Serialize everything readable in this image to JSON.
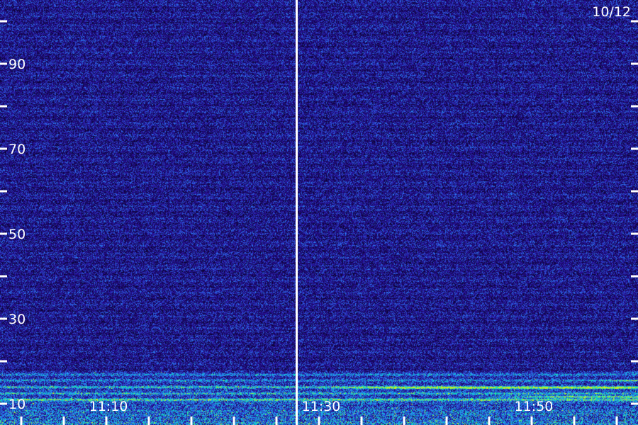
{
  "date_label": "10/12",
  "chart_data": {
    "type": "heatmap",
    "title": "",
    "xlabel": "",
    "ylabel": "",
    "y_range": [
      5,
      105
    ],
    "x_range_minutes": [
      0,
      60
    ],
    "y_ticks": [
      10,
      20,
      30,
      40,
      50,
      60,
      70,
      80,
      90,
      100
    ],
    "y_tick_labels": [
      {
        "value": 10,
        "label": "10"
      },
      {
        "value": 30,
        "label": "30"
      },
      {
        "value": 50,
        "label": "50"
      },
      {
        "value": 70,
        "label": "70"
      },
      {
        "value": 90,
        "label": "90"
      }
    ],
    "x_tick_labels": [
      {
        "minute": 10,
        "label": "11:10"
      },
      {
        "minute": 30,
        "label": "11:30"
      },
      {
        "minute": 50,
        "label": "11:50"
      }
    ],
    "x_minor_ticks_minutes": [
      2,
      6,
      10,
      14,
      18,
      22,
      26,
      30,
      34,
      38,
      42,
      46,
      50,
      54,
      58
    ],
    "divider_minute": 27.9,
    "colors": {
      "background": "#0a0330",
      "noise": "#2a10a0",
      "band_low": "#2a8cff",
      "band_mid": "#00e0c0",
      "band_high": "#c8f020",
      "axis": "#ffffff"
    },
    "low_bands": [
      {
        "y": 11.0,
        "strength": 0.9
      },
      {
        "y": 12.5,
        "strength": 0.8
      },
      {
        "y": 14.0,
        "strength": 0.7
      },
      {
        "y": 15.5,
        "strength": 0.55
      },
      {
        "y": 17.0,
        "strength": 0.45
      }
    ],
    "emerging_lines": [
      {
        "y": 11.7,
        "start_minute": 44,
        "strength": 1.0
      },
      {
        "y": 13.8,
        "start_minute": 29,
        "strength": 0.85
      },
      {
        "y": 15.5,
        "start_minute": 55,
        "strength": 0.9
      },
      {
        "y": 17.5,
        "start_minute": 56,
        "strength": 0.7
      }
    ]
  }
}
